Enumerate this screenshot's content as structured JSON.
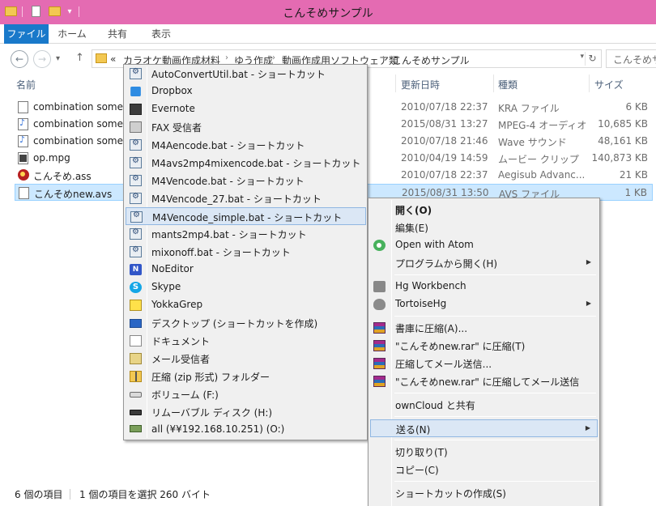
{
  "window": {
    "title": "こんそめサンプル"
  },
  "ribbon": {
    "tabs": [
      "ファイル",
      "ホーム",
      "共有",
      "表示"
    ]
  },
  "address": {
    "overflow": "«",
    "crumbs": [
      "カラオケ動画作成材料",
      "ゆう作成",
      "動画作成用ソフトウェア類",
      "こんそめサンプル"
    ],
    "separator": "›",
    "search_placeholder": "こんそめサン"
  },
  "columns": {
    "name": "名前",
    "date": "更新日時",
    "type": "種類",
    "size": "サイズ"
  },
  "files": [
    {
      "name": "combination somet",
      "date": "2010/07/18 22:37",
      "type": "KRA ファイル",
      "size": "6 KB",
      "icon": "document-icon"
    },
    {
      "name": "combination somet",
      "date": "2015/08/31 13:27",
      "type": "MPEG-4 オーディオ",
      "size": "10,685 KB",
      "icon": "audio-file-icon"
    },
    {
      "name": "combination somet",
      "date": "2010/07/18 21:46",
      "type": "Wave サウンド",
      "size": "48,161 KB",
      "icon": "audio-file-icon"
    },
    {
      "name": "op.mpg",
      "date": "2010/04/19 14:59",
      "type": "ムービー クリップ",
      "size": "140,873 KB",
      "icon": "video-file-icon"
    },
    {
      "name": "こんそめ.ass",
      "date": "2010/07/18 22:37",
      "type": "Aegisub Advanc...",
      "size": "21 KB",
      "icon": "aegisub-icon"
    },
    {
      "name": "こんそめnew.avs",
      "date": "2015/08/31 13:50",
      "type": "AVS ファイル",
      "size": "1 KB",
      "icon": "document-icon",
      "selected": true
    }
  ],
  "status": {
    "count": "6 個の項目",
    "selection": "1 個の項目を選択  260 バイト"
  },
  "sendto": {
    "items": [
      {
        "label": "AutoConvertUtil.bat - ショートカット",
        "icon": "shortcut-icon"
      },
      {
        "label": "Dropbox",
        "icon": "dropbox-icon"
      },
      {
        "label": "Evernote",
        "icon": "evernote-icon"
      },
      {
        "label": "FAX 受信者",
        "icon": "fax-icon"
      },
      {
        "label": "M4Aencode.bat - ショートカット",
        "icon": "shortcut-icon"
      },
      {
        "label": "M4avs2mp4mixencode.bat - ショートカット",
        "icon": "shortcut-icon"
      },
      {
        "label": "M4Vencode.bat - ショートカット",
        "icon": "shortcut-icon"
      },
      {
        "label": "M4Vencode_27.bat - ショートカット",
        "icon": "shortcut-icon"
      },
      {
        "label": "M4Vencode_simple.bat - ショートカット",
        "icon": "shortcut-icon",
        "highlighted": true
      },
      {
        "label": "mants2mp4.bat - ショートカット",
        "icon": "shortcut-icon"
      },
      {
        "label": "mixonoff.bat - ショートカット",
        "icon": "shortcut-icon"
      },
      {
        "label": "NoEditor",
        "icon": "noeditor-icon"
      },
      {
        "label": "Skype",
        "icon": "skype-icon"
      },
      {
        "label": "YokkaGrep",
        "icon": "yokkagrep-icon"
      },
      {
        "label": "デスクトップ (ショートカットを作成)",
        "icon": "desktop-icon"
      },
      {
        "label": "ドキュメント",
        "icon": "documents-icon"
      },
      {
        "label": "メール受信者",
        "icon": "mail-icon"
      },
      {
        "label": "圧縮 (zip 形式) フォルダー",
        "icon": "zip-folder-icon"
      },
      {
        "label": "ボリューム (F:)",
        "icon": "drive-icon"
      },
      {
        "label": "リムーバブル ディスク (H:)",
        "icon": "removable-drive-icon"
      },
      {
        "label": "all (¥¥192.168.10.251) (O:)",
        "icon": "network-drive-icon"
      }
    ]
  },
  "context": {
    "open": "開く(O)",
    "edit": "編集(E)",
    "atom": "Open with Atom",
    "open_with": "プログラムから開く(H)",
    "hg_workbench": "Hg Workbench",
    "tortoisehg": "TortoiseHg",
    "rar_add": "書庫に圧縮(A)...",
    "rar_named": "\"こんそめnew.rar\" に圧縮(T)",
    "rar_mail": "圧縮してメール送信...",
    "rar_named_mail": "\"こんそめnew.rar\" に圧縮してメール送信",
    "owncloud": "ownCloud と共有",
    "send_to": "送る(N)",
    "cut": "切り取り(T)",
    "copy": "コピー(C)",
    "create_shortcut": "ショートカットの作成(S)"
  },
  "colors": {
    "titlebar": "#e46bb2",
    "file_tab": "#1979ca",
    "selection": "#cce8ff",
    "menu_highlight": "#dbe7f5"
  }
}
